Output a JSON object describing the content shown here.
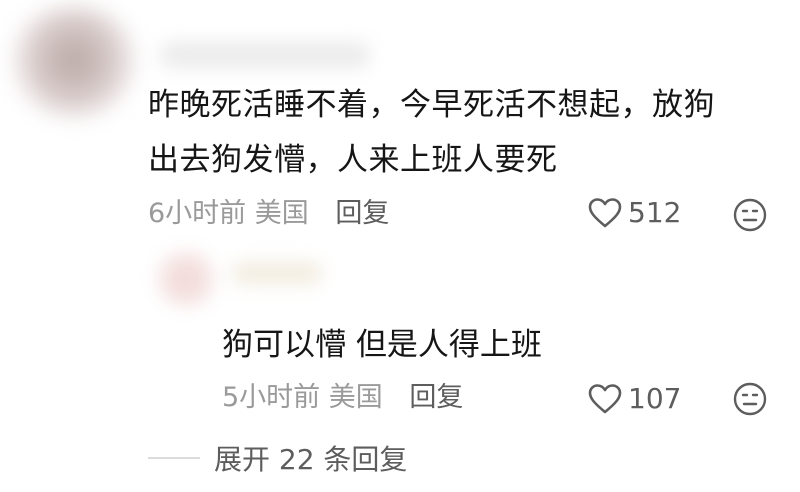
{
  "comment": {
    "text_line1": "昨晚死活睡不着，今早死活不想起，放狗",
    "text_line2": "出去狗发懵，人来上班人要死",
    "time": "6小时前",
    "location": "美国",
    "reply_label": "回复",
    "likes": "512"
  },
  "reply": {
    "text": "狗可以懵 但是人得上班",
    "time": "5小时前",
    "location": "美国",
    "reply_label": "回复",
    "likes": "107"
  },
  "expand": {
    "label": "展开 22 条回复"
  },
  "icons": {
    "like": "heart-outline-icon",
    "dislike": "neutral-face-icon"
  }
}
